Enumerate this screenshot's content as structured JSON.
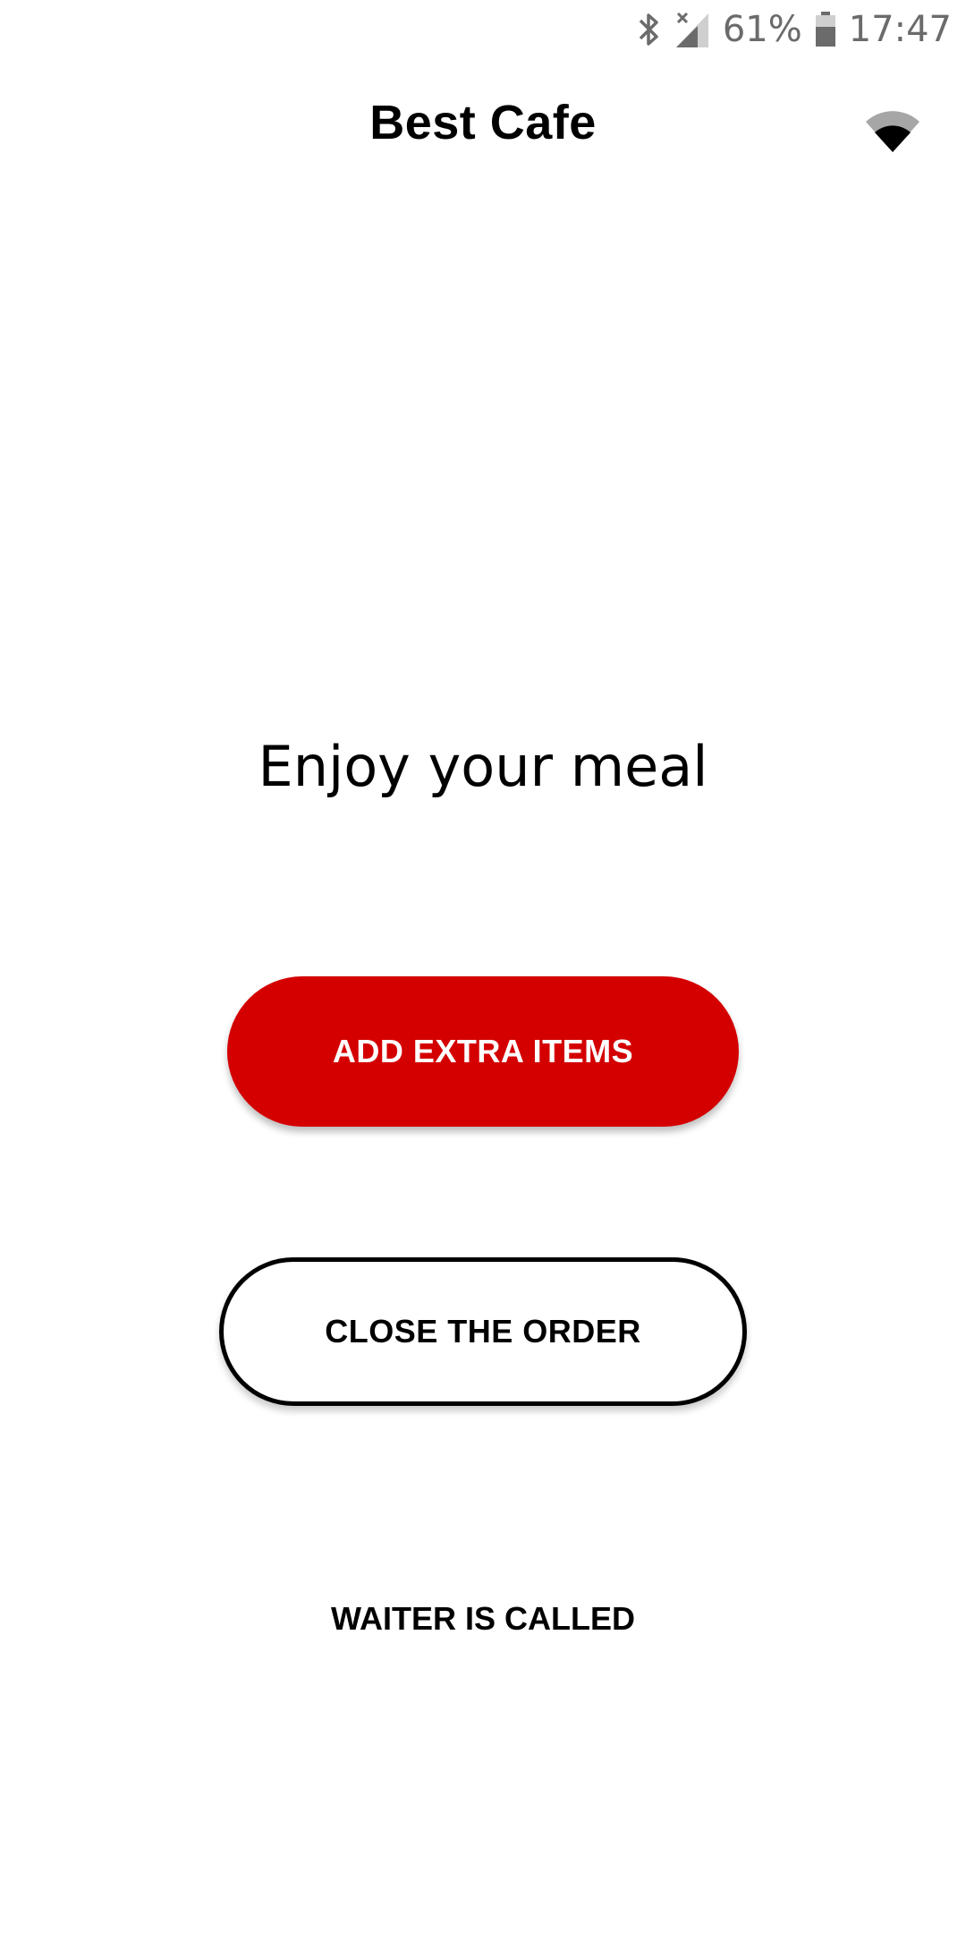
{
  "status_bar": {
    "battery_percent": "61%",
    "time": "17:47",
    "icons": [
      "bluetooth-icon",
      "signal-icon",
      "battery-icon"
    ]
  },
  "app_bar": {
    "title": "Best Cafe",
    "wifi_icon": "wifi-icon"
  },
  "main": {
    "message": "Enjoy your meal",
    "add_button_label": "ADD EXTRA ITEMS",
    "close_button_label": "CLOSE THE ORDER",
    "waiter_status": "WAITER IS CALLED"
  },
  "colors": {
    "accent": "#d40000",
    "text": "#000000",
    "status": "#6b6b6b",
    "background": "#ffffff"
  }
}
